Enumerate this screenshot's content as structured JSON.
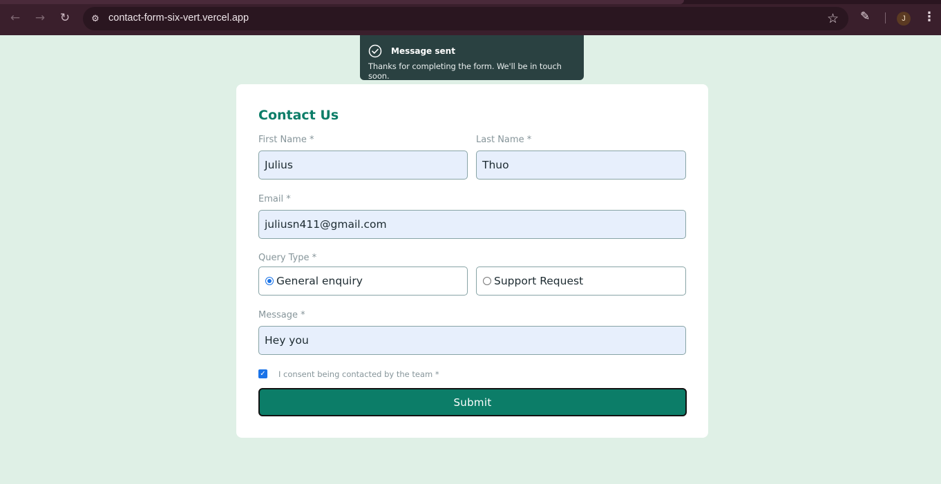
{
  "browser": {
    "url": "contact-form-six-vert.vercel.app",
    "profile_initial": "J"
  },
  "toast": {
    "title": "Message sent",
    "body": "Thanks for completing the form. We'll be in touch soon."
  },
  "form": {
    "title": "Contact Us",
    "first_name_label": "First Name *",
    "first_name_value": "Julius",
    "last_name_label": "Last Name *",
    "last_name_value": "Thuo",
    "email_label": "Email *",
    "email_value": "juliusn411@gmail.com",
    "query_type_label": "Query Type *",
    "query_options": [
      {
        "label": "General enquiry",
        "checked": true
      },
      {
        "label": "Support Request",
        "checked": false
      }
    ],
    "message_label": "Message *",
    "message_value": "Hey you",
    "consent_label": "I consent being contacted by the team *",
    "consent_checked": true,
    "submit_label": "Submit"
  },
  "colors": {
    "page_bg": "#dff0e6",
    "accent": "#0c7d68",
    "toast_bg": "#2a4141",
    "browser_bg": "#3a1f2c"
  }
}
